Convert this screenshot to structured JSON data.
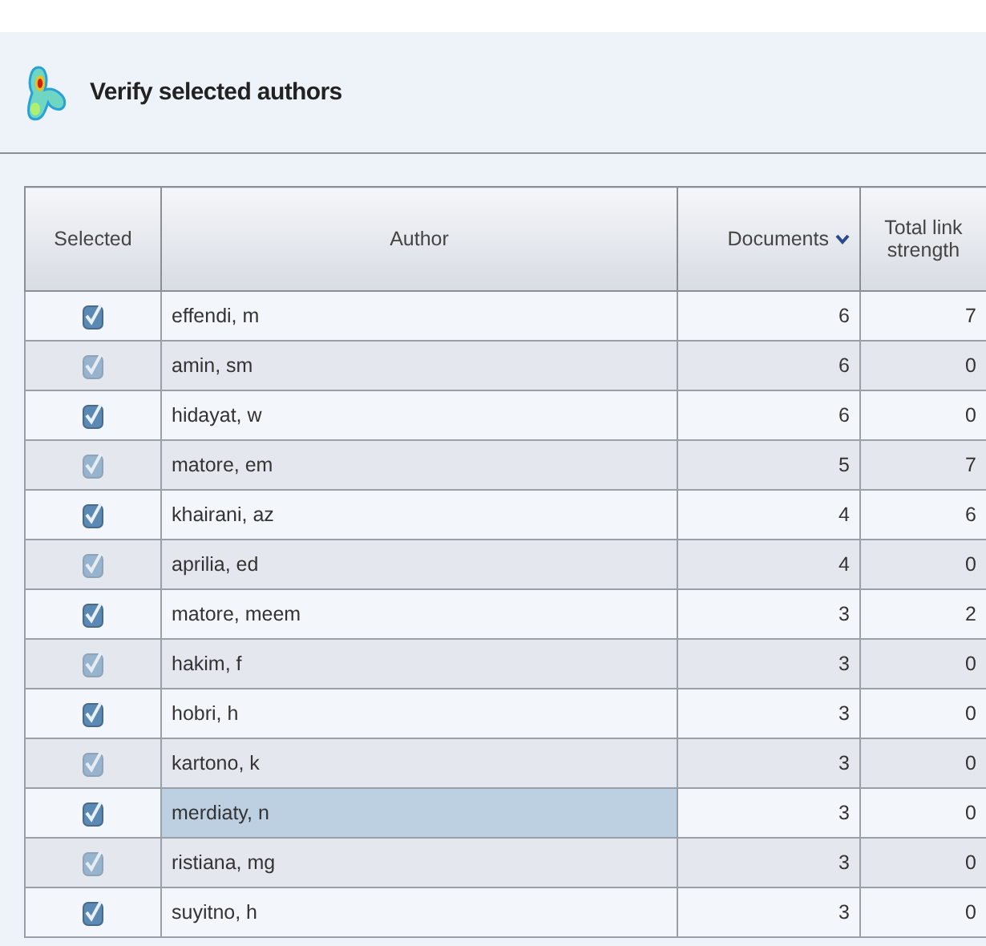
{
  "header": {
    "title": "Verify selected authors"
  },
  "table": {
    "columns": [
      {
        "label": "Selected"
      },
      {
        "label": "Author"
      },
      {
        "label": "Documents",
        "sorted": true
      },
      {
        "label": "Total link strength"
      }
    ],
    "rows": [
      {
        "checked": true,
        "author": "effendi, m",
        "documents": "6",
        "total_link_strength": "7",
        "selected": false
      },
      {
        "checked": true,
        "author": "amin, sm",
        "documents": "6",
        "total_link_strength": "0",
        "selected": false
      },
      {
        "checked": true,
        "author": "hidayat, w",
        "documents": "6",
        "total_link_strength": "0",
        "selected": false
      },
      {
        "checked": true,
        "author": "matore, em",
        "documents": "5",
        "total_link_strength": "7",
        "selected": false
      },
      {
        "checked": true,
        "author": "khairani, az",
        "documents": "4",
        "total_link_strength": "6",
        "selected": false
      },
      {
        "checked": true,
        "author": "aprilia, ed",
        "documents": "4",
        "total_link_strength": "0",
        "selected": false
      },
      {
        "checked": true,
        "author": "matore, meem",
        "documents": "3",
        "total_link_strength": "2",
        "selected": false
      },
      {
        "checked": true,
        "author": "hakim, f",
        "documents": "3",
        "total_link_strength": "0",
        "selected": false
      },
      {
        "checked": true,
        "author": "hobri, h",
        "documents": "3",
        "total_link_strength": "0",
        "selected": false
      },
      {
        "checked": true,
        "author": "kartono, k",
        "documents": "3",
        "total_link_strength": "0",
        "selected": false
      },
      {
        "checked": true,
        "author": "merdiaty, n",
        "documents": "3",
        "total_link_strength": "0",
        "selected": true
      },
      {
        "checked": true,
        "author": "ristiana, mg",
        "documents": "3",
        "total_link_strength": "0",
        "selected": false
      },
      {
        "checked": true,
        "author": "suyitno, h",
        "documents": "3",
        "total_link_strength": "0",
        "selected": false
      }
    ]
  }
}
